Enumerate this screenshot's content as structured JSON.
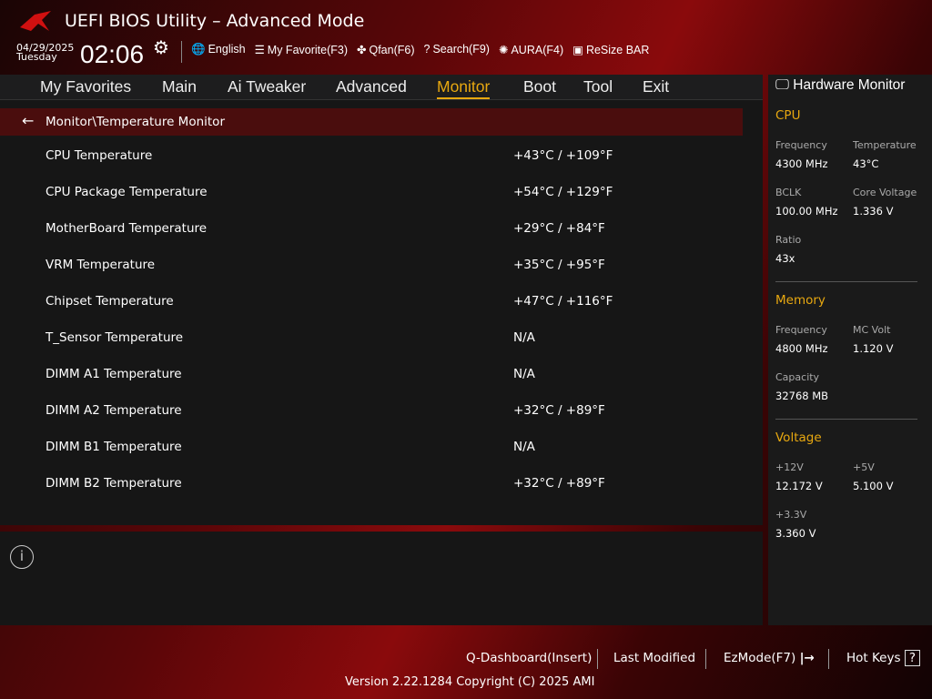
{
  "header": {
    "title": "UEFI BIOS Utility – Advanced Mode",
    "date": "04/29/2025",
    "day": "Tuesday",
    "time": "02:06",
    "tools": [
      {
        "icon": "globe-icon",
        "glyph": "🌐",
        "label": "English"
      },
      {
        "icon": "favorite-icon",
        "glyph": "☰",
        "label": "My Favorite(F3)"
      },
      {
        "icon": "fan-icon",
        "glyph": "✤",
        "label": "Qfan(F6)"
      },
      {
        "icon": "search-help-icon",
        "glyph": "?",
        "label": "Search(F9)"
      },
      {
        "icon": "aura-icon",
        "glyph": "✺",
        "label": "AURA(F4)"
      },
      {
        "icon": "resize-bar-icon",
        "glyph": "▣",
        "label": "ReSize BAR"
      }
    ]
  },
  "nav": [
    {
      "label": "My Favorites"
    },
    {
      "label": "Main"
    },
    {
      "label": "Ai Tweaker"
    },
    {
      "label": "Advanced"
    },
    {
      "label": "Monitor",
      "active": true
    },
    {
      "label": "Boot"
    },
    {
      "label": "Tool"
    },
    {
      "label": "Exit"
    }
  ],
  "breadcrumb": "Monitor\\Temperature Monitor",
  "rows": [
    {
      "label": "CPU Temperature",
      "value": "+43°C / +109°F"
    },
    {
      "label": "CPU Package Temperature",
      "value": "+54°C / +129°F"
    },
    {
      "label": "MotherBoard Temperature",
      "value": "+29°C / +84°F"
    },
    {
      "label": "VRM Temperature",
      "value": "+35°C / +95°F"
    },
    {
      "label": "Chipset Temperature",
      "value": "+47°C / +116°F"
    },
    {
      "label": "T_Sensor Temperature",
      "value": " N/A"
    },
    {
      "label": "DIMM A1 Temperature",
      "value": " N/A"
    },
    {
      "label": "DIMM A2 Temperature",
      "value": "+32°C / +89°F"
    },
    {
      "label": "DIMM B1 Temperature",
      "value": " N/A"
    },
    {
      "label": "DIMM B2 Temperature",
      "value": "+32°C / +89°F"
    }
  ],
  "hw": {
    "title": "Hardware Monitor",
    "cpu": {
      "title": "CPU",
      "frequency_label": "Frequency",
      "frequency": "4300 MHz",
      "temp_label": "Temperature",
      "temp": "43°C",
      "bclk_label": "BCLK",
      "bclk": "100.00 MHz",
      "vcore_label": "Core Voltage",
      "vcore": "1.336 V",
      "ratio_label": "Ratio",
      "ratio": "43x"
    },
    "memory": {
      "title": "Memory",
      "frequency_label": "Frequency",
      "frequency": "4800 MHz",
      "mcvolt_label": "MC Volt",
      "mcvolt": "1.120 V",
      "capacity_label": "Capacity",
      "capacity": "32768 MB"
    },
    "voltage": {
      "title": "Voltage",
      "v12_label": "+12V",
      "v12": "12.172 V",
      "v5_label": "+5V",
      "v5": "5.100 V",
      "v33_label": "+3.3V",
      "v33": "3.360 V"
    }
  },
  "footer": {
    "qdash": "Q-Dashboard(Insert)",
    "last": "Last Modified",
    "ezmode": "EzMode(F7)",
    "hotkeys": "Hot Keys",
    "hotkeys_glyph": "?",
    "version": "Version 2.22.1284 Copyright (C) 2025 AMI"
  }
}
